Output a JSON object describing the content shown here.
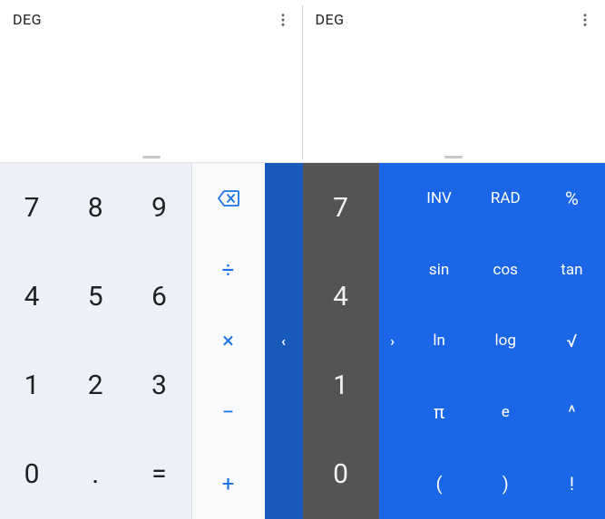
{
  "left": {
    "mode": "DEG",
    "digits": [
      "7",
      "8",
      "9",
      "4",
      "5",
      "6",
      "1",
      "2",
      "3",
      "0",
      ".",
      "="
    ],
    "ops": {
      "divide": "÷",
      "multiply": "×",
      "minus": "−",
      "plus": "+"
    },
    "peek_chevron": "‹"
  },
  "right": {
    "mode": "DEG",
    "digits_column": [
      "7",
      "4",
      "1",
      "0"
    ],
    "handle_chevron": "›",
    "advanced": [
      {
        "name": "inv",
        "label": "INV"
      },
      {
        "name": "rad",
        "label": "RAD"
      },
      {
        "name": "percent",
        "label": "%"
      },
      {
        "name": "sin",
        "label": "sin"
      },
      {
        "name": "cos",
        "label": "cos"
      },
      {
        "name": "tan",
        "label": "tan"
      },
      {
        "name": "ln",
        "label": "ln"
      },
      {
        "name": "log",
        "label": "log"
      },
      {
        "name": "sqrt",
        "label": "√"
      },
      {
        "name": "pi",
        "label": "π"
      },
      {
        "name": "e",
        "label": "e"
      },
      {
        "name": "power",
        "label": "^"
      },
      {
        "name": "lparen",
        "label": "("
      },
      {
        "name": "rparen",
        "label": ")"
      },
      {
        "name": "factorial",
        "label": "!"
      }
    ]
  },
  "colors": {
    "accent_blue": "#1a73e8",
    "panel_blue": "#1b66e6",
    "digit_bg": "#edf0f6",
    "dark_col": "#545454"
  }
}
